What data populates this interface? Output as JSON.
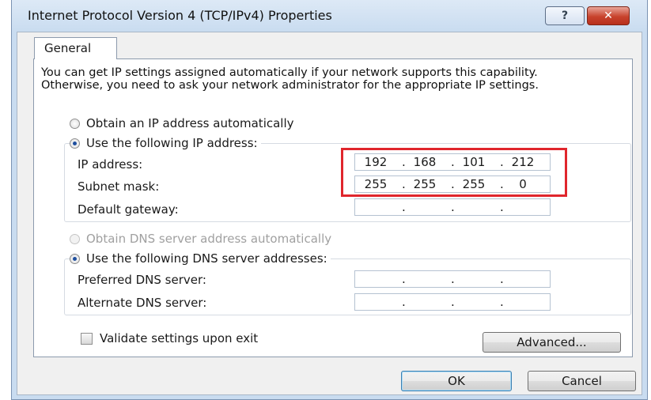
{
  "window": {
    "title": "Internet Protocol Version 4 (TCP/IPv4) Properties",
    "help_label": "?",
    "close_label": "✕"
  },
  "tabs": [
    {
      "label": "General",
      "selected": true
    }
  ],
  "description": "You can get IP settings assigned automatically if your network supports this capability. Otherwise, you need to ask your network administrator for the appropriate IP settings.",
  "ip_settings": {
    "auto_option": {
      "label": "Obtain an IP address automatically",
      "selected": false
    },
    "manual_option": {
      "label": "Use the following IP address:",
      "selected": true
    },
    "fields": [
      {
        "label": "IP address:",
        "octets": [
          "192",
          "168",
          "101",
          "212"
        ]
      },
      {
        "label": "Subnet mask:",
        "octets": [
          "255",
          "255",
          "255",
          "0"
        ]
      },
      {
        "label": "Default gateway:",
        "octets": [
          "",
          "",
          "",
          ""
        ]
      }
    ]
  },
  "dns_settings": {
    "auto_option": {
      "label": "Obtain DNS server address automatically",
      "selected": false,
      "enabled": false
    },
    "manual_option": {
      "label": "Use the following DNS server addresses:",
      "selected": true
    },
    "fields": [
      {
        "label": "Preferred DNS server:",
        "octets": [
          "",
          "",
          "",
          ""
        ]
      },
      {
        "label": "Alternate DNS server:",
        "octets": [
          "",
          "",
          "",
          ""
        ]
      }
    ]
  },
  "validate": {
    "label": "Validate settings upon exit",
    "checked": false
  },
  "buttons": {
    "advanced": "Advanced...",
    "ok": "OK",
    "cancel": "Cancel"
  },
  "colors": {
    "highlight_border": "#e0262c",
    "title_bar": "#c9dcf0",
    "close_button": "#c8432d"
  }
}
